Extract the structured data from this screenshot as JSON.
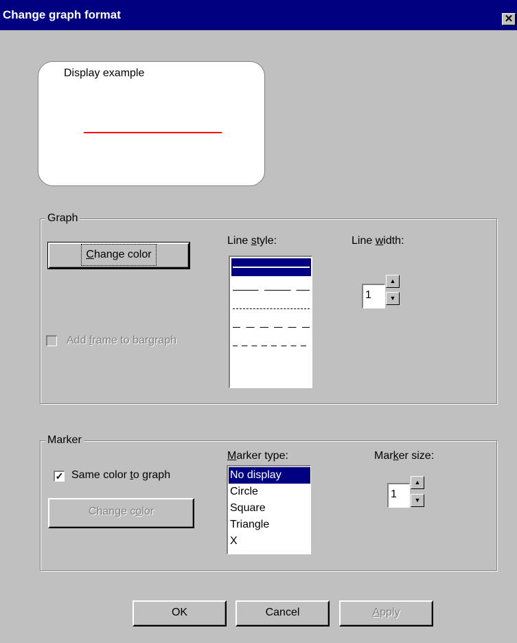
{
  "window": {
    "title": "Change graph format",
    "close_glyph": "✕"
  },
  "preview": {
    "label": "Display example",
    "line_color": "#ff0000"
  },
  "graph_group": {
    "title": "Graph",
    "change_color": {
      "pre": "",
      "accel": "C",
      "post": "hange color"
    },
    "add_frame": {
      "pre": "Add ",
      "accel": "f",
      "post": "rame to bargraph",
      "checked": false,
      "enabled": false
    },
    "line_style": {
      "pre": "Line ",
      "accel": "s",
      "post": "tyle:",
      "options": [
        "solid",
        "dash",
        "dot",
        "dash-dot",
        "dash-dot-dot",
        "none"
      ],
      "selected_index": 0
    },
    "line_width": {
      "pre": "Line ",
      "accel": "w",
      "post": "idth:",
      "value": "1"
    }
  },
  "marker_group": {
    "title": "Marker",
    "same_color": {
      "pre": "Same color ",
      "accel": "t",
      "post": "o graph",
      "checked": true
    },
    "change_color": {
      "pre": "Change c",
      "accel": "o",
      "post": "lor",
      "enabled": false
    },
    "marker_type": {
      "pre": "",
      "accel": "M",
      "post": "arker type:",
      "options": [
        "No display",
        "Circle",
        "Square",
        "Triangle",
        "X"
      ],
      "selected": "No display"
    },
    "marker_size": {
      "pre": "Mar",
      "accel": "k",
      "post": "er size:",
      "value": "1"
    }
  },
  "buttons": {
    "ok": "OK",
    "cancel": "Cancel",
    "apply": {
      "pre": "",
      "accel": "A",
      "post": "pply",
      "enabled": false
    }
  },
  "colors": {
    "titlebar": "#000080",
    "face": "#c0c0c0",
    "selection": "#000080"
  }
}
